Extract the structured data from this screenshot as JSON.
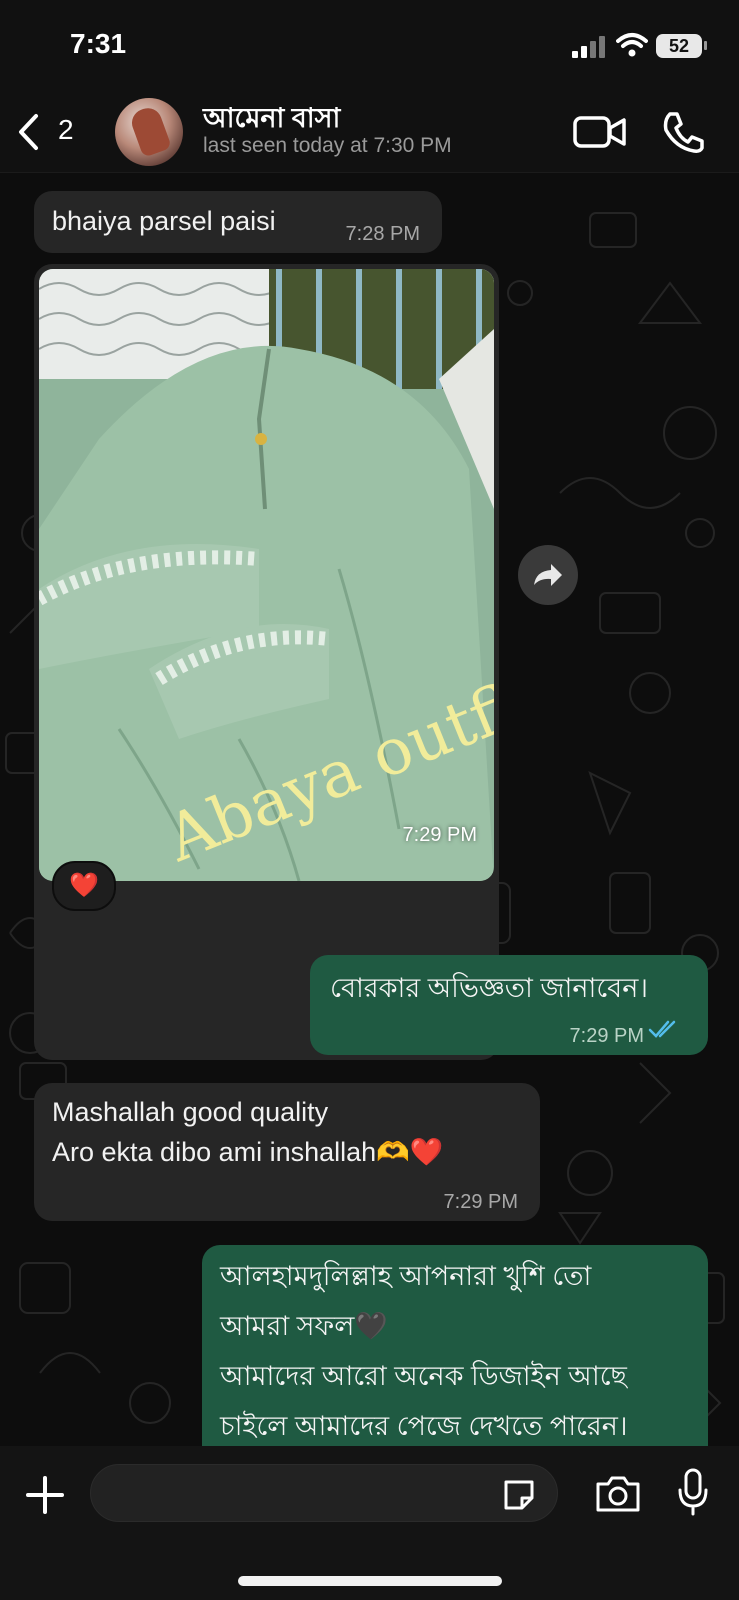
{
  "status_bar": {
    "time": "7:31",
    "battery": "52"
  },
  "header": {
    "back_count": "2",
    "contact_name": "আমেনা বাসা",
    "contact_status": "last seen today at 7:30 PM"
  },
  "messages": [
    {
      "type": "incoming",
      "text": "bhaiya parsel paisi",
      "time": "7:28 PM"
    },
    {
      "type": "incoming_image",
      "overlay_text": "Abaya outfit",
      "time": "7:29 PM",
      "reaction": "❤️"
    },
    {
      "type": "outgoing",
      "text": "বোরকার অভিজ্ঞতা জানাবেন।",
      "time": "7:29 PM",
      "status": "read"
    },
    {
      "type": "incoming",
      "lines": [
        "Mashallah good quality",
        "Aro ekta dibo ami inshallah🫶❤️"
      ],
      "time": "7:29 PM"
    },
    {
      "type": "outgoing",
      "lines": [
        "আলহামদুলিল্লাহ আপনারা খুশি তো",
        "আমরা সফল🖤",
        "আমাদের আরো অনেক ডিজাইন আছে",
        "চাইলে আমাদের পেজে দেখতে পারেন।"
      ]
    }
  ],
  "composer": {
    "placeholder": ""
  },
  "colors": {
    "incoming_bubble": "#262626",
    "outgoing_bubble": "#1f5a42",
    "read_tick": "#53bdeb"
  }
}
